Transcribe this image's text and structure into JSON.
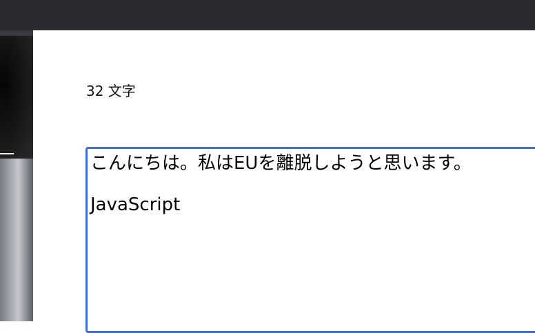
{
  "counter": {
    "text": "32 文字"
  },
  "editor": {
    "lines": [
      "こんにちは。私はEUを離脱しようと思います。",
      "",
      "JavaScript"
    ]
  },
  "colors": {
    "top_bar": "#2a2b30",
    "editor_border": "#3a6fd6",
    "background": "#ffffff"
  }
}
